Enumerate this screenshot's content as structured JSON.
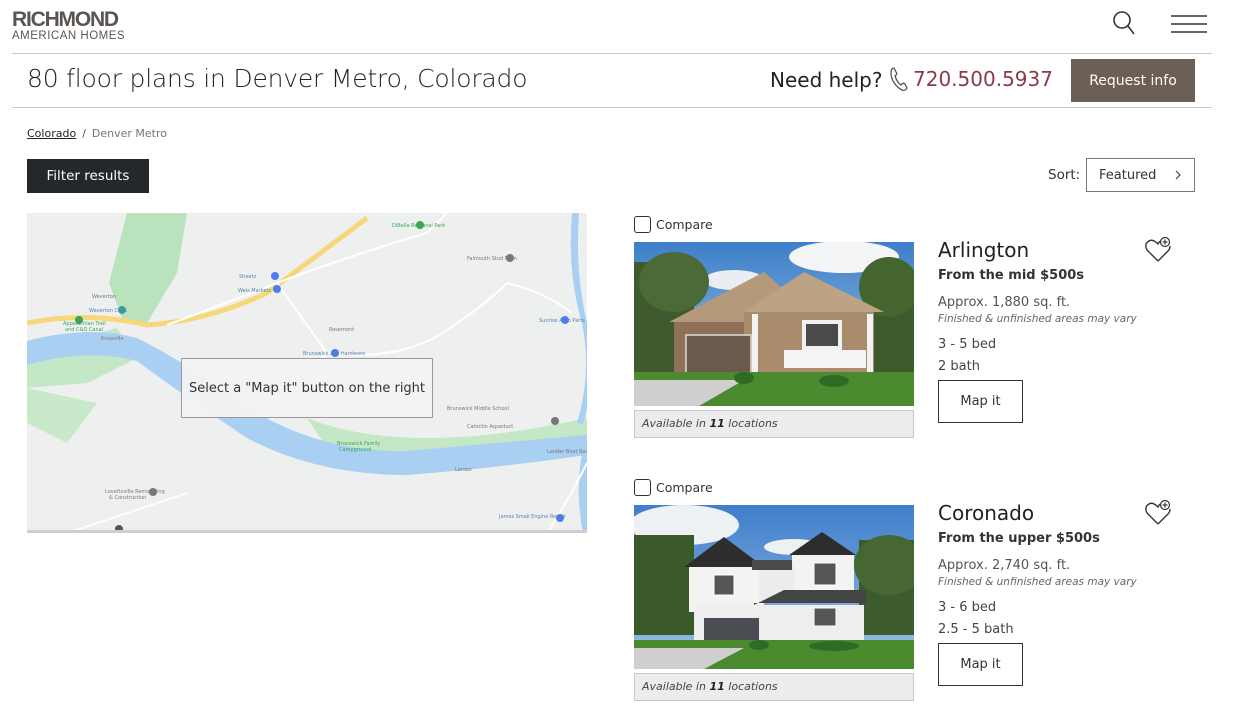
{
  "header": {
    "logo_main": "RICHMOND",
    "logo_sub": "AMERICAN HOMES",
    "search_icon": "search-icon",
    "menu_icon": "hamburger-menu-icon"
  },
  "title_bar": {
    "page_title": "80 floor plans in Denver Metro, Colorado",
    "need_help": "Need help?",
    "phone_icon": "phone-icon",
    "phone": "720.500.5937",
    "request_info": "Request info"
  },
  "breadcrumb": {
    "items": [
      {
        "label": "Colorado",
        "link": true
      },
      {
        "label": "Denver Metro",
        "link": false
      }
    ],
    "separator": "/"
  },
  "toolbar": {
    "filter_label": "Filter results",
    "sort_label": "Sort:",
    "sort_value": "Featured"
  },
  "map": {
    "overlay_text": "Select a \"Map it\" button on the right",
    "labels": [
      "Waverton Cliffs",
      "Appalachian Trail and C&O Canal",
      "Weverton",
      "Sheetz",
      "Weis Markets",
      "DiBella Regional Park",
      "Rosemont",
      "Brunswick Ace Hardware",
      "Falmouth Stud Farm",
      "Brunswick Middle School",
      "Brunswick Family Campground",
      "Catoctin Aqueduct",
      "Lovettsville Remodeling & Construction",
      "Lander",
      "James Small Engine Repair",
      "Knoxville",
      "Lander Boat Ramp"
    ]
  },
  "colors": {
    "accent_brown": "#6b5f56",
    "phone_red": "#8c3a47",
    "filter_dark": "#24272b"
  },
  "plans": [
    {
      "compare_label": "Compare",
      "name": "Arlington",
      "price": "From the mid $500s",
      "sqft": "Approx. 1,880 sq. ft.",
      "note": "Finished & unfinished areas may vary",
      "beds": "3 - 5 bed",
      "baths": "2 bath",
      "map_it": "Map it",
      "avail_prefix": "Available in",
      "avail_count": "11",
      "avail_suffix": "locations",
      "favorite_icon": "heart-plus-icon"
    },
    {
      "compare_label": "Compare",
      "name": "Coronado",
      "price": "From the upper $500s",
      "sqft": "Approx. 2,740 sq. ft.",
      "note": "Finished & unfinished areas may vary",
      "beds": "3 - 6 bed",
      "baths": "2.5 - 5 bath",
      "map_it": "Map it",
      "avail_prefix": "Available in",
      "avail_count": "11",
      "avail_suffix": "locations",
      "favorite_icon": "heart-plus-icon"
    }
  ]
}
